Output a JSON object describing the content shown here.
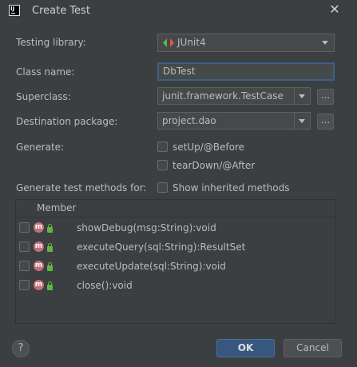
{
  "window": {
    "title": "Create Test",
    "close_glyph": "✕",
    "app_icon_text": "IJ"
  },
  "form": {
    "testing_library_label": "Testing library:",
    "testing_library_value": "JUnit4",
    "class_name_label": "Class name:",
    "class_name_value": "DbTest",
    "superclass_label": "Superclass:",
    "superclass_value": "junit.framework.TestCase",
    "destination_label": "Destination package:",
    "destination_value": "project.dao",
    "browse_label": "...",
    "generate_label": "Generate:",
    "setup_label": "setUp/@Before",
    "setup_checked": false,
    "teardown_label": "tearDown/@After",
    "teardown_checked": false,
    "methods_label": "Generate test methods for:",
    "inherited_label": "Show inherited methods",
    "inherited_checked": false
  },
  "table": {
    "header": "Member",
    "icon_letter": "m",
    "rows": [
      {
        "signature": "showDebug(msg:String):void",
        "checked": false
      },
      {
        "signature": "executeQuery(sql:String):ResultSet",
        "checked": false
      },
      {
        "signature": "executeUpdate(sql:String):void",
        "checked": false
      },
      {
        "signature": "close():void",
        "checked": false
      }
    ]
  },
  "footer": {
    "help_glyph": "?",
    "ok_label": "OK",
    "cancel_label": "Cancel"
  },
  "colors": {
    "background": "#3c3f41",
    "ok_button": "#365880",
    "method_icon": "#c36f77",
    "lock_icon": "#62b543"
  }
}
